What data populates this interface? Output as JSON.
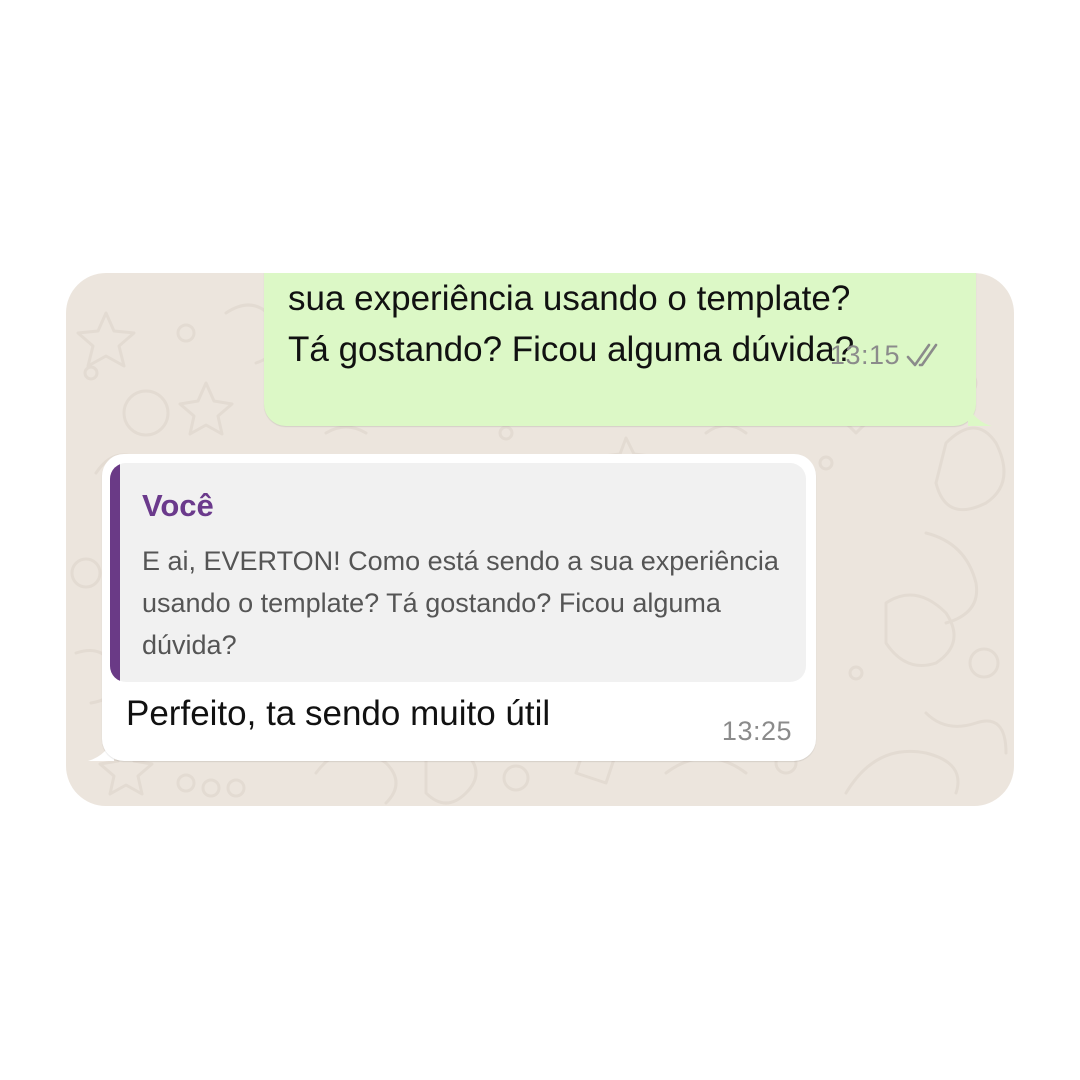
{
  "outgoing_message": {
    "text": "sua experiência usando o template?\nTá gostando? Ficou alguma dúvida?",
    "time": "13:15",
    "status_icon": "double-check-icon"
  },
  "incoming_message": {
    "quoted": {
      "author": "Você",
      "text": "E ai, EVERTON! Como está sendo a sua experiência usando o template? Tá gostando? Ficou alguma dúvida?"
    },
    "text": "Perfeito, ta sendo muito útil",
    "time": "13:25"
  },
  "colors": {
    "wallpaper": "#ece5dd",
    "outgoing_bubble": "#dcf8c6",
    "incoming_bubble": "#ffffff",
    "quote_accent": "#6a3a86"
  }
}
